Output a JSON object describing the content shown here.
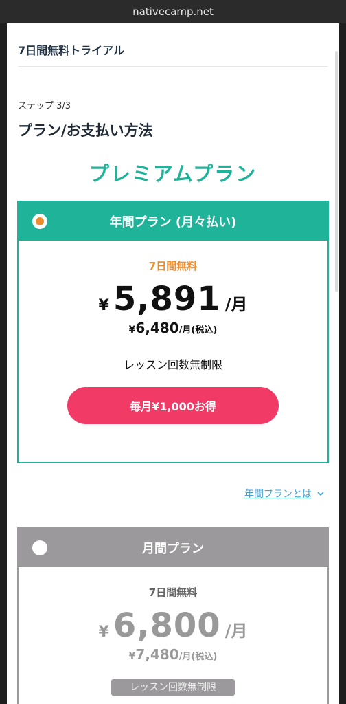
{
  "browser": {
    "url": "nativecamp.net"
  },
  "header": {
    "title": "7日間無料トライアル"
  },
  "step": {
    "label": "ステップ 3/3"
  },
  "section": {
    "title": "プラン/お支払い方法"
  },
  "premium": {
    "title": "プレミアムプラン"
  },
  "plans": [
    {
      "name": "年間プラン (月々払い)",
      "selected": true,
      "free_label": "7日間無料",
      "currency": "¥",
      "price": "5,891",
      "per": "/月",
      "tax_currency": "¥",
      "tax_price": "6,480",
      "tax_unit": "/月(税込)",
      "lessons": "レッスン回数無制限",
      "save_button": "毎月¥1,000お得"
    },
    {
      "name": "月間プラン",
      "selected": false,
      "free_label": "7日間無料",
      "currency": "¥",
      "price": "6,800",
      "per": "/月",
      "tax_currency": "¥",
      "tax_price": "7,480",
      "tax_unit": "/月(税込)",
      "lessons": "レッスン回数無制限"
    }
  ],
  "about_link": {
    "label": "年間プランとは",
    "icon": "chevron-down-icon"
  },
  "colors": {
    "accent": "#1fb49a",
    "orange": "#ee8d2f",
    "pink": "#f23a66",
    "gray": "#9b999b",
    "link": "#3fa4d7"
  }
}
